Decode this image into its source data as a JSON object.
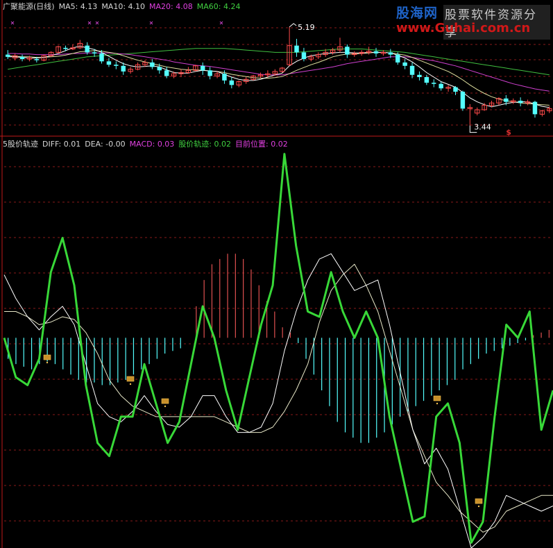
{
  "top_panel": {
    "stock_name": "广聚能源(日线)",
    "indicators": [
      {
        "label": "MA5: 4.13",
        "color": "#d8d8d8"
      },
      {
        "label": "MA10: 4.10",
        "color": "#d8d8d8"
      },
      {
        "label": "MA20: 4.08",
        "color": "#e040e0"
      },
      {
        "label": "MA60: 4.24",
        "color": "#40d040"
      }
    ],
    "high_label": "5.19",
    "low_label": "3.44",
    "signal_marker": "$"
  },
  "bottom_panel": {
    "indicators": [
      {
        "label": "5股价轨迹",
        "color": "#d8d8d8"
      },
      {
        "label": "DIFF: 0.01",
        "color": "#d8d8d8"
      },
      {
        "label": "DEA: -0.00",
        "color": "#d8d8d8"
      },
      {
        "label": "MACD: 0.03",
        "color": "#e040e0"
      },
      {
        "label": "股价轨迹: 0.02",
        "color": "#40d040"
      },
      {
        "label": "目前位置: 0.02",
        "color": "#e040e0"
      }
    ]
  },
  "logo": {
    "main": "股海网",
    "sub": "股票软件资源分享",
    "url": "www.Guhai.com.cn"
  },
  "colors": {
    "up": "#ff4a4a",
    "down": "#54ffff",
    "ma60": "#40c040",
    "ma20": "#d040d0",
    "ma5": "#ffffff",
    "ma10": "#e0e0a0",
    "gridline": "#8a1a1a",
    "trajectory": "#38d838",
    "diff": "#ffffff",
    "dea": "#e8e8c8",
    "macd_pos": "#e05050",
    "macd_neg": "#54ffff"
  },
  "chart_data": [
    {
      "type": "candlestick",
      "title": "广聚能源(日线)",
      "ylim": [
        3.3,
        5.3
      ],
      "candles": [
        [
          4.7,
          4.78,
          4.66,
          4.62
        ],
        [
          4.64,
          4.72,
          4.68,
          4.6
        ],
        [
          4.66,
          4.7,
          4.62,
          4.58
        ],
        [
          4.62,
          4.68,
          4.64,
          4.58
        ],
        [
          4.62,
          4.66,
          4.6,
          4.56
        ],
        [
          4.6,
          4.7,
          4.68,
          4.58
        ],
        [
          4.68,
          4.76,
          4.74,
          4.66
        ],
        [
          4.74,
          4.86,
          4.84,
          4.72
        ],
        [
          4.82,
          4.86,
          4.8,
          4.76
        ],
        [
          4.8,
          4.88,
          4.82,
          4.78
        ],
        [
          4.82,
          4.96,
          4.9,
          4.8
        ],
        [
          4.86,
          4.92,
          4.74,
          4.7
        ],
        [
          4.74,
          4.8,
          4.72,
          4.66
        ],
        [
          4.72,
          4.78,
          4.58,
          4.54
        ],
        [
          4.58,
          4.64,
          4.52,
          4.48
        ],
        [
          4.52,
          4.58,
          4.5,
          4.44
        ],
        [
          4.5,
          4.56,
          4.4,
          4.34
        ],
        [
          4.4,
          4.48,
          4.44,
          4.36
        ],
        [
          4.44,
          4.56,
          4.52,
          4.42
        ],
        [
          4.52,
          4.6,
          4.56,
          4.48
        ],
        [
          4.56,
          4.62,
          4.48,
          4.44
        ],
        [
          4.48,
          4.54,
          4.42,
          4.36
        ],
        [
          4.42,
          4.48,
          4.32,
          4.28
        ],
        [
          4.32,
          4.4,
          4.36,
          4.28
        ],
        [
          4.36,
          4.44,
          4.38,
          4.3
        ],
        [
          4.38,
          4.48,
          4.42,
          4.36
        ],
        [
          4.42,
          4.52,
          4.5,
          4.4
        ],
        [
          4.5,
          4.56,
          4.42,
          4.34
        ],
        [
          4.42,
          4.48,
          4.32,
          4.26
        ],
        [
          4.32,
          4.4,
          4.36,
          4.28
        ],
        [
          4.36,
          4.42,
          4.24,
          4.18
        ],
        [
          4.24,
          4.3,
          4.16,
          4.1
        ],
        [
          4.16,
          4.24,
          4.22,
          4.12
        ],
        [
          4.22,
          4.3,
          4.26,
          4.18
        ],
        [
          4.26,
          4.34,
          4.32,
          4.24
        ],
        [
          4.32,
          4.38,
          4.34,
          4.28
        ],
        [
          4.34,
          4.42,
          4.36,
          4.3
        ],
        [
          4.36,
          4.44,
          4.4,
          4.32
        ],
        [
          4.4,
          4.48,
          4.46,
          4.38
        ],
        [
          4.52,
          5.19,
          4.86,
          4.5
        ],
        [
          4.86,
          4.98,
          4.74,
          4.66
        ],
        [
          4.74,
          4.82,
          4.62,
          4.58
        ],
        [
          4.62,
          4.7,
          4.66,
          4.58
        ],
        [
          4.66,
          4.74,
          4.7,
          4.62
        ],
        [
          4.7,
          4.8,
          4.74,
          4.66
        ],
        [
          4.74,
          4.82,
          4.78,
          4.7
        ],
        [
          4.78,
          5.0,
          4.84,
          4.74
        ],
        [
          4.84,
          4.88,
          4.7,
          4.64
        ],
        [
          4.7,
          4.76,
          4.72,
          4.66
        ],
        [
          4.72,
          4.78,
          4.74,
          4.68
        ],
        [
          4.74,
          4.84,
          4.76,
          4.7
        ],
        [
          4.76,
          4.82,
          4.72,
          4.66
        ],
        [
          4.72,
          4.78,
          4.74,
          4.68
        ],
        [
          4.74,
          4.8,
          4.7,
          4.64
        ],
        [
          4.7,
          4.74,
          4.56,
          4.52
        ],
        [
          4.56,
          4.62,
          4.5,
          4.44
        ],
        [
          4.5,
          4.56,
          4.34,
          4.28
        ],
        [
          4.34,
          4.4,
          4.3,
          4.24
        ],
        [
          4.3,
          4.34,
          4.2,
          4.16
        ],
        [
          4.2,
          4.26,
          4.18,
          4.12
        ],
        [
          4.18,
          4.22,
          4.1,
          4.06
        ],
        [
          4.1,
          4.16,
          4.12,
          4.04
        ],
        [
          4.12,
          4.14,
          4.04,
          3.98
        ],
        [
          4.04,
          4.06,
          3.74,
          3.7
        ],
        [
          3.74,
          3.82,
          3.76,
          3.44
        ],
        [
          3.66,
          3.76,
          3.72,
          3.62
        ],
        [
          3.72,
          3.84,
          3.8,
          3.7
        ],
        [
          3.8,
          3.88,
          3.84,
          3.76
        ],
        [
          3.84,
          3.94,
          3.92,
          3.8
        ],
        [
          3.92,
          3.98,
          3.86,
          3.8
        ],
        [
          3.86,
          3.92,
          3.88,
          3.82
        ],
        [
          3.88,
          3.94,
          3.84,
          3.78
        ],
        [
          3.84,
          3.9,
          3.86,
          3.8
        ],
        [
          3.86,
          3.88,
          3.64,
          3.58
        ],
        [
          3.64,
          3.72,
          3.7,
          3.6
        ],
        [
          3.7,
          3.78,
          3.74,
          3.66
        ]
      ],
      "ma5": [
        4.66,
        4.66,
        4.65,
        4.64,
        4.64,
        4.65,
        4.68,
        4.72,
        4.77,
        4.82,
        4.85,
        4.82,
        4.79,
        4.74,
        4.67,
        4.6,
        4.54,
        4.5,
        4.48,
        4.49,
        4.5,
        4.48,
        4.43,
        4.38,
        4.37,
        4.37,
        4.4,
        4.42,
        4.41,
        4.4,
        4.35,
        4.3,
        4.26,
        4.24,
        4.24,
        4.26,
        4.3,
        4.34,
        4.37,
        4.5,
        4.58,
        4.64,
        4.68,
        4.7,
        4.72,
        4.73,
        4.74,
        4.74,
        4.73,
        4.73,
        4.74,
        4.74,
        4.74,
        4.73,
        4.69,
        4.64,
        4.57,
        4.48,
        4.38,
        4.3,
        4.22,
        4.17,
        4.12,
        4.03,
        3.93,
        3.86,
        3.81,
        3.77,
        3.8,
        3.83,
        3.85,
        3.86,
        3.86,
        3.82,
        3.78,
        3.76
      ],
      "ma10": [
        4.68,
        4.67,
        4.66,
        4.66,
        4.65,
        4.65,
        4.66,
        4.67,
        4.69,
        4.72,
        4.75,
        4.76,
        4.77,
        4.76,
        4.74,
        4.72,
        4.68,
        4.64,
        4.6,
        4.57,
        4.54,
        4.51,
        4.48,
        4.46,
        4.44,
        4.43,
        4.43,
        4.42,
        4.41,
        4.4,
        4.38,
        4.35,
        4.33,
        4.31,
        4.29,
        4.28,
        4.28,
        4.29,
        4.31,
        4.36,
        4.42,
        4.47,
        4.52,
        4.56,
        4.61,
        4.66,
        4.69,
        4.71,
        4.71,
        4.72,
        4.73,
        4.74,
        4.74,
        4.73,
        4.71,
        4.69,
        4.65,
        4.6,
        4.55,
        4.5,
        4.45,
        4.4,
        4.33,
        4.25,
        4.16,
        4.08,
        4.01,
        3.95,
        3.91,
        3.88,
        3.86,
        3.84,
        3.83,
        3.82,
        3.81,
        3.8
      ],
      "ma20": [
        4.72,
        4.72,
        4.71,
        4.71,
        4.7,
        4.7,
        4.7,
        4.7,
        4.71,
        4.72,
        4.72,
        4.73,
        4.73,
        4.73,
        4.73,
        4.72,
        4.71,
        4.7,
        4.68,
        4.66,
        4.64,
        4.62,
        4.6,
        4.57,
        4.55,
        4.53,
        4.51,
        4.5,
        4.49,
        4.47,
        4.45,
        4.43,
        4.41,
        4.39,
        4.37,
        4.35,
        4.34,
        4.34,
        4.34,
        4.36,
        4.38,
        4.4,
        4.42,
        4.44,
        4.46,
        4.48,
        4.51,
        4.54,
        4.56,
        4.58,
        4.6,
        4.62,
        4.64,
        4.66,
        4.66,
        4.66,
        4.65,
        4.63,
        4.61,
        4.59,
        4.56,
        4.53,
        4.5,
        4.46,
        4.42,
        4.38,
        4.34,
        4.3,
        4.26,
        4.22,
        4.18,
        4.15,
        4.12,
        4.09,
        4.07,
        4.05
      ],
      "ma60": [
        4.44,
        4.46,
        4.48,
        4.5,
        4.52,
        4.54,
        4.56,
        4.58,
        4.6,
        4.62,
        4.64,
        4.66,
        4.67,
        4.68,
        4.69,
        4.7,
        4.71,
        4.72,
        4.73,
        4.74,
        4.75,
        4.76,
        4.77,
        4.78,
        4.79,
        4.8,
        4.81,
        4.81,
        4.81,
        4.81,
        4.81,
        4.8,
        4.79,
        4.78,
        4.77,
        4.76,
        4.75,
        4.74,
        4.74,
        4.74,
        4.74,
        4.75,
        4.76,
        4.77,
        4.78,
        4.79,
        4.8,
        4.8,
        4.8,
        4.8,
        4.79,
        4.78,
        4.77,
        4.76,
        4.75,
        4.74,
        4.72,
        4.7,
        4.68,
        4.66,
        4.64,
        4.62,
        4.6,
        4.58,
        4.56,
        4.54,
        4.52,
        4.5,
        4.48,
        4.46,
        4.44,
        4.42,
        4.4,
        4.38,
        4.36,
        4.34
      ]
    },
    {
      "type": "line",
      "ylim": [
        -0.8,
        0.72
      ],
      "series": [
        {
          "name": "股价轨迹",
          "values": [
            0.0,
            -0.15,
            -0.18,
            -0.08,
            0.25,
            0.38,
            0.2,
            -0.18,
            -0.4,
            -0.45,
            -0.3,
            -0.3,
            -0.1,
            -0.25,
            -0.4,
            -0.32,
            -0.1,
            0.12,
            0.0,
            -0.2,
            -0.35,
            -0.15,
            0.05,
            0.2,
            0.7,
            0.35,
            0.1,
            0.08,
            0.25,
            0.1,
            0.0,
            0.1,
            0.0,
            -0.3,
            -0.5,
            -0.7,
            -0.68,
            -0.3,
            -0.25,
            -0.4,
            -0.78,
            -0.7,
            -0.3,
            0.05,
            0.0,
            0.1,
            -0.35,
            -0.2
          ]
        },
        {
          "name": "DIFF",
          "values": [
            0.24,
            0.15,
            0.08,
            0.03,
            0.08,
            0.12,
            0.05,
            -0.1,
            -0.25,
            -0.3,
            -0.32,
            -0.28,
            -0.22,
            -0.28,
            -0.33,
            -0.34,
            -0.3,
            -0.22,
            -0.22,
            -0.3,
            -0.36,
            -0.36,
            -0.34,
            -0.25,
            -0.05,
            0.1,
            0.22,
            0.3,
            0.32,
            0.25,
            0.18,
            0.2,
            0.22,
            0.05,
            -0.15,
            -0.35,
            -0.48,
            -0.42,
            -0.5,
            -0.65,
            -0.8,
            -0.76,
            -0.7,
            -0.6,
            -0.62,
            -0.64,
            -0.66,
            -0.64
          ]
        },
        {
          "name": "DEA",
          "values": [
            0.1,
            0.1,
            0.08,
            0.05,
            0.06,
            0.08,
            0.07,
            0.02,
            -0.06,
            -0.16,
            -0.22,
            -0.26,
            -0.28,
            -0.3,
            -0.3,
            -0.3,
            -0.3,
            -0.3,
            -0.3,
            -0.32,
            -0.34,
            -0.36,
            -0.36,
            -0.34,
            -0.28,
            -0.2,
            -0.1,
            0.06,
            0.18,
            0.24,
            0.28,
            0.2,
            0.1,
            -0.05,
            -0.2,
            -0.35,
            -0.45,
            -0.55,
            -0.6,
            -0.66,
            -0.7,
            -0.74,
            -0.72,
            -0.66,
            -0.64,
            -0.62,
            -0.6,
            -0.6
          ]
        }
      ],
      "macd": [
        -0.08,
        -0.1,
        -0.11,
        -0.12,
        -0.1,
        -0.09,
        -0.1,
        -0.12,
        -0.14,
        -0.16,
        -0.17,
        -0.17,
        -0.18,
        -0.18,
        -0.17,
        -0.16,
        -0.14,
        -0.12,
        -0.1,
        -0.08,
        -0.06,
        -0.05,
        -0.04,
        0.0,
        0.12,
        0.22,
        0.28,
        0.3,
        0.32,
        0.32,
        0.3,
        0.26,
        0.2,
        0.14,
        0.1,
        0.04,
        0.02,
        -0.02,
        -0.08,
        -0.14,
        -0.2,
        -0.26,
        -0.32,
        -0.36,
        -0.38,
        -0.4,
        -0.4,
        -0.38,
        -0.36,
        -0.33,
        -0.3,
        -0.28,
        -0.26,
        -0.24,
        -0.22,
        -0.2,
        -0.18,
        -0.16,
        -0.12,
        -0.1,
        -0.08,
        -0.06,
        -0.05,
        -0.04,
        -0.03,
        -0.02,
        -0.01,
        0.01,
        0.02,
        0.03
      ]
    }
  ]
}
